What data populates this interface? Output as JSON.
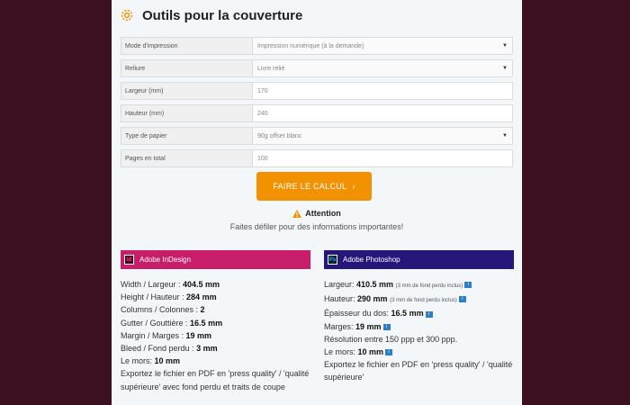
{
  "header": {
    "title": "Outils pour la couverture"
  },
  "form": {
    "rows": [
      {
        "label": "Mode d'impression",
        "value": "Impression numérique (à la demande)",
        "type": "select"
      },
      {
        "label": "Reliure",
        "value": "Livre relié",
        "type": "select"
      },
      {
        "label": "Largeur (mm)",
        "value": "170",
        "type": "input"
      },
      {
        "label": "Hauteur (mm)",
        "value": "240",
        "type": "input"
      },
      {
        "label": "Type de papier",
        "value": "90g offset blanc",
        "type": "select"
      },
      {
        "label": "Pages en total",
        "value": "100",
        "type": "input"
      }
    ]
  },
  "calc_button": {
    "label": "FAIRE LE CALCUL",
    "arrow": "›"
  },
  "warning": {
    "title": "Attention",
    "text": "Faites défiler pour des informations importantes!"
  },
  "indesign": {
    "badge": "Id",
    "title": "Adobe InDesign",
    "lines": [
      {
        "label": "Width / Largeur : ",
        "value": "404.5 mm"
      },
      {
        "label": "Height / Hauteur : ",
        "value": "284 mm"
      },
      {
        "label": "Columns / Colonnes : ",
        "value": "2"
      },
      {
        "label": "Gutter / Gouttière : ",
        "value": "16.5 mm"
      },
      {
        "label": "Margin / Marges : ",
        "value": "19 mm"
      },
      {
        "label": "Bleed / Fond perdu : ",
        "value": "3 mm"
      },
      {
        "label": "Le mors: ",
        "value": "10 mm"
      }
    ],
    "export_text": "Exportez le fichier en PDF en 'press quality' / 'qualité supérieure' avec fond perdu et traits de coupe"
  },
  "photoshop": {
    "badge": "Ps",
    "title": "Adobe Photoshop",
    "lines": [
      {
        "label": "Largeur: ",
        "value": "410.5 mm",
        "note": "(3 mm de fond perdu inclus)"
      },
      {
        "label": "Hauteur: ",
        "value": "290 mm",
        "note": "(3 mm de fond perdu inclus)"
      },
      {
        "label": "Épaisseur du dos: ",
        "value": "16.5 mm",
        "note": ""
      },
      {
        "label": "Marges: ",
        "value": "19 mm",
        "note": ""
      },
      {
        "label": "Résolution entre 150 ppp et 300 ppp.",
        "value": "",
        "note": ""
      },
      {
        "label": "Le mors: ",
        "value": "10 mm",
        "note": ""
      }
    ],
    "export_text": "Exportez le fichier en PDF en 'press quality' / 'qualité supérieure'"
  },
  "colors": {
    "accent": "#f39200",
    "indesign": "#c81e6a",
    "photoshop": "#25177a",
    "background": "#3b1020"
  }
}
